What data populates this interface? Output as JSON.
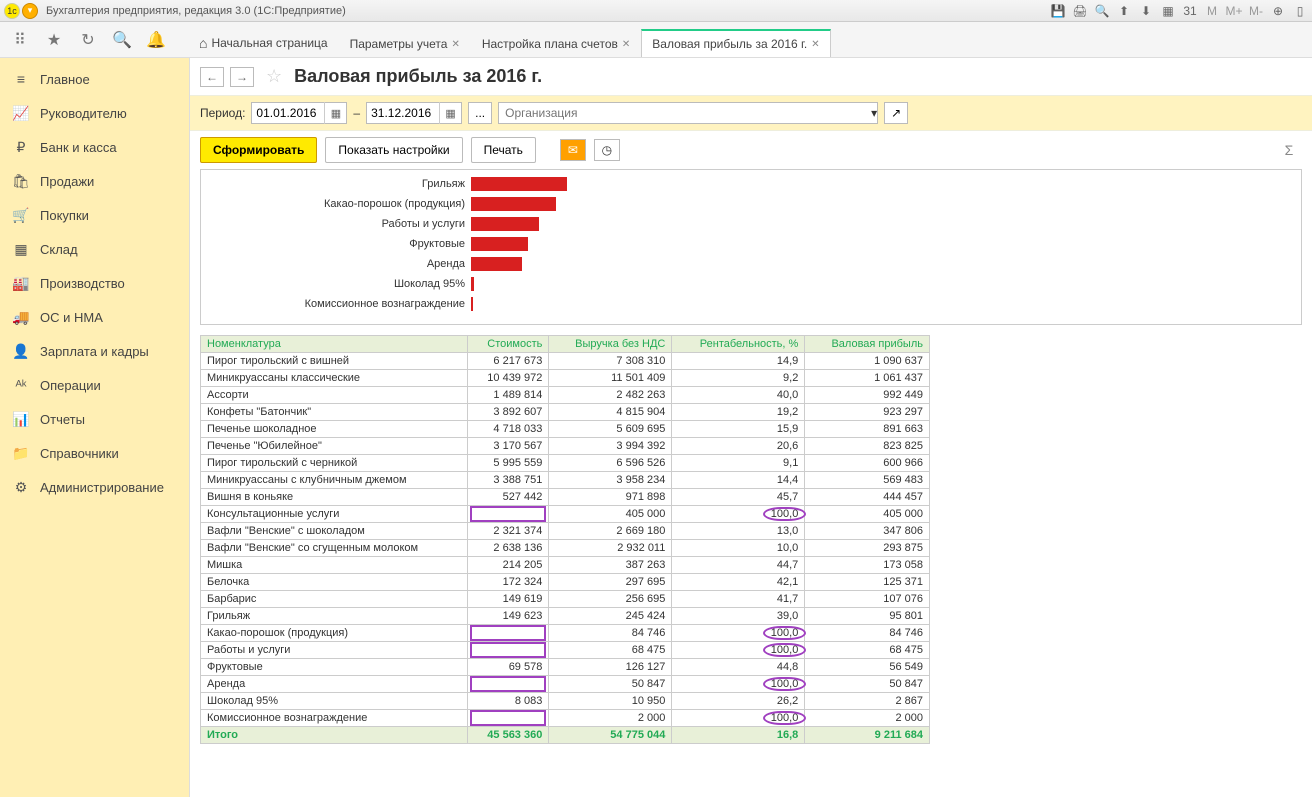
{
  "window_title": "Бухгалтерия предприятия, редакция 3.0  (1С:Предприятие)",
  "tabs": [
    {
      "label": "Начальная страница",
      "closable": false,
      "home": true
    },
    {
      "label": "Параметры учета",
      "closable": true
    },
    {
      "label": "Настройка плана счетов",
      "closable": true
    },
    {
      "label": "Валовая прибыль за 2016 г.",
      "closable": true,
      "active": true
    }
  ],
  "sidebar": {
    "items": [
      {
        "icon": "≡",
        "label": "Главное"
      },
      {
        "icon": "📈",
        "label": "Руководителю"
      },
      {
        "icon": "₽",
        "label": "Банк и касса"
      },
      {
        "icon": "🛍",
        "label": "Продажи"
      },
      {
        "icon": "🛒",
        "label": "Покупки"
      },
      {
        "icon": "▦",
        "label": "Склад"
      },
      {
        "icon": "🏭",
        "label": "Производство"
      },
      {
        "icon": "🚚",
        "label": "ОС и НМА"
      },
      {
        "icon": "👤",
        "label": "Зарплата и кадры"
      },
      {
        "icon": "ᴬᵏ",
        "label": "Операции"
      },
      {
        "icon": "📊",
        "label": "Отчеты"
      },
      {
        "icon": "📁",
        "label": "Справочники"
      },
      {
        "icon": "⚙",
        "label": "Администрирование"
      }
    ]
  },
  "page": {
    "title": "Валовая прибыль за 2016 г.",
    "period_label": "Период:",
    "date_from": "01.01.2016",
    "date_to": "31.12.2016",
    "dash": "–",
    "ellipsis": "...",
    "org_placeholder": "Организация",
    "btn_generate": "Сформировать",
    "btn_settings": "Показать настройки",
    "btn_print": "Печать",
    "sigma": "Σ"
  },
  "chart_data": {
    "type": "bar",
    "orientation": "horizontal",
    "categories": [
      "Грильяж",
      "Какао-порошок (продукция)",
      "Работы и услуги",
      "Фруктовые",
      "Аренда",
      "Шоколад 95%",
      "Комиссионное вознаграждение"
    ],
    "values": [
      95801,
      84746,
      68475,
      56549,
      50847,
      2867,
      2000
    ],
    "max": 100000
  },
  "table": {
    "headers": [
      "Номенклатура",
      "Стоимость",
      "Выручка без НДС",
      "Рентабельность, %",
      "Валовая прибыль"
    ],
    "rows": [
      {
        "name": "Пирог тирольский с вишней",
        "cost": "6 217 673",
        "rev": "7 308 310",
        "profit": "14,9",
        "gross": "1 090 637"
      },
      {
        "name": "Миникруассаны классические",
        "cost": "10 439 972",
        "rev": "11 501 409",
        "profit": "9,2",
        "gross": "1 061 437"
      },
      {
        "name": "Ассорти",
        "cost": "1 489 814",
        "rev": "2 482 263",
        "profit": "40,0",
        "gross": "992 449"
      },
      {
        "name": "Конфеты \"Батончик\"",
        "cost": "3 892 607",
        "rev": "4 815 904",
        "profit": "19,2",
        "gross": "923 297"
      },
      {
        "name": "Печенье шоколадное",
        "cost": "4 718 033",
        "rev": "5 609 695",
        "profit": "15,9",
        "gross": "891 663"
      },
      {
        "name": "Печенье \"Юбилейное\"",
        "cost": "3 170 567",
        "rev": "3 994 392",
        "profit": "20,6",
        "gross": "823 825"
      },
      {
        "name": "Пирог тирольский с черникой",
        "cost": "5 995 559",
        "rev": "6 596 526",
        "profit": "9,1",
        "gross": "600 966"
      },
      {
        "name": "Миникруассаны с клубничным джемом",
        "cost": "3 388 751",
        "rev": "3 958 234",
        "profit": "14,4",
        "gross": "569 483"
      },
      {
        "name": "Вишня в коньяке",
        "cost": "527 442",
        "rev": "971 898",
        "profit": "45,7",
        "gross": "444 457"
      },
      {
        "name": "Консультационные услуги",
        "cost": "",
        "rev": "405 000",
        "profit": "100,0",
        "gross": "405 000",
        "box": true,
        "circ": true
      },
      {
        "name": "Вафли \"Венские\" с шоколадом",
        "cost": "2 321 374",
        "rev": "2 669 180",
        "profit": "13,0",
        "gross": "347 806"
      },
      {
        "name": "Вафли \"Венские\" со сгущенным молоком",
        "cost": "2 638 136",
        "rev": "2 932 011",
        "profit": "10,0",
        "gross": "293 875"
      },
      {
        "name": "Мишка",
        "cost": "214 205",
        "rev": "387 263",
        "profit": "44,7",
        "gross": "173 058"
      },
      {
        "name": "Белочка",
        "cost": "172 324",
        "rev": "297 695",
        "profit": "42,1",
        "gross": "125 371"
      },
      {
        "name": "Барбарис",
        "cost": "149 619",
        "rev": "256 695",
        "profit": "41,7",
        "gross": "107 076"
      },
      {
        "name": "Грильяж",
        "cost": "149 623",
        "rev": "245 424",
        "profit": "39,0",
        "gross": "95 801"
      },
      {
        "name": "Какао-порошок (продукция)",
        "cost": "",
        "rev": "84 746",
        "profit": "100,0",
        "gross": "84 746",
        "box": true,
        "circ": true
      },
      {
        "name": "Работы и услуги",
        "cost": "",
        "rev": "68 475",
        "profit": "100,0",
        "gross": "68 475",
        "box": true,
        "circ": true
      },
      {
        "name": "Фруктовые",
        "cost": "69 578",
        "rev": "126 127",
        "profit": "44,8",
        "gross": "56 549"
      },
      {
        "name": "Аренда",
        "cost": "",
        "rev": "50 847",
        "profit": "100,0",
        "gross": "50 847",
        "box": true,
        "circ": true
      },
      {
        "name": "Шоколад 95%",
        "cost": "8 083",
        "rev": "10 950",
        "profit": "26,2",
        "gross": "2 867"
      },
      {
        "name": "Комиссионное вознаграждение",
        "cost": "",
        "rev": "2 000",
        "profit": "100,0",
        "gross": "2 000",
        "box": true,
        "circ": true
      }
    ],
    "total": {
      "name": "Итого",
      "cost": "45 563 360",
      "rev": "54 775 044",
      "profit": "16,8",
      "gross": "9 211 684"
    }
  }
}
